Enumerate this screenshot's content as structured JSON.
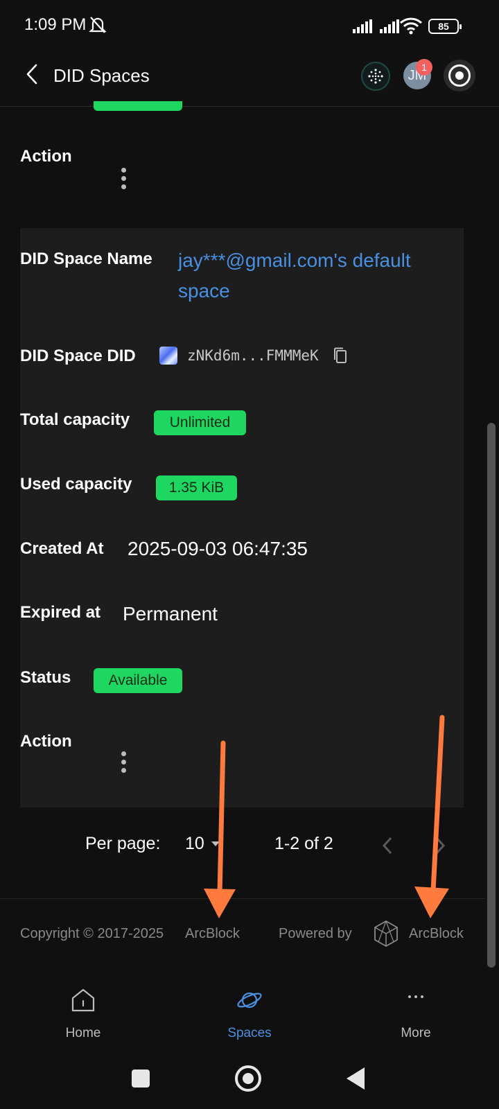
{
  "status_bar": {
    "time": "1:09 PM",
    "battery": "85"
  },
  "app_bar": {
    "title": "DID Spaces",
    "avatar_initials": "JM",
    "notification_count": "1"
  },
  "previous_item": {
    "action_label": "Action"
  },
  "space": {
    "name_label": "DID Space Name",
    "name_value": "jay***@gmail.com's default space",
    "did_label": "DID Space DID",
    "did_value": "zNKd6m...FMMMeK",
    "total_capacity_label": "Total capacity",
    "total_capacity_value": "Unlimited",
    "used_capacity_label": "Used capacity",
    "used_capacity_value": "1.35 KiB",
    "created_label": "Created At",
    "created_value": "2025-09-03 06:47:35",
    "expired_label": "Expired at",
    "expired_value": "Permanent",
    "status_label": "Status",
    "status_value": "Available",
    "action_label": "Action"
  },
  "pagination": {
    "per_page_label": "Per page:",
    "per_page_value": "10",
    "range": "1-2 of 2"
  },
  "footer": {
    "copyright": "Copyright © 2017-2025",
    "copyright_link": "ArcBlock",
    "powered_by": "Powered by",
    "brand": "ArcBlock"
  },
  "bottom_nav": [
    {
      "label": "Home",
      "icon": "home-icon",
      "active": false
    },
    {
      "label": "Spaces",
      "icon": "planet-icon",
      "active": true
    },
    {
      "label": "More",
      "icon": "more-icon",
      "active": false
    }
  ],
  "colors": {
    "accent": "#4a90e2",
    "tag_green": "#1ed760",
    "annotation_arrow": "#ff7a3d"
  }
}
